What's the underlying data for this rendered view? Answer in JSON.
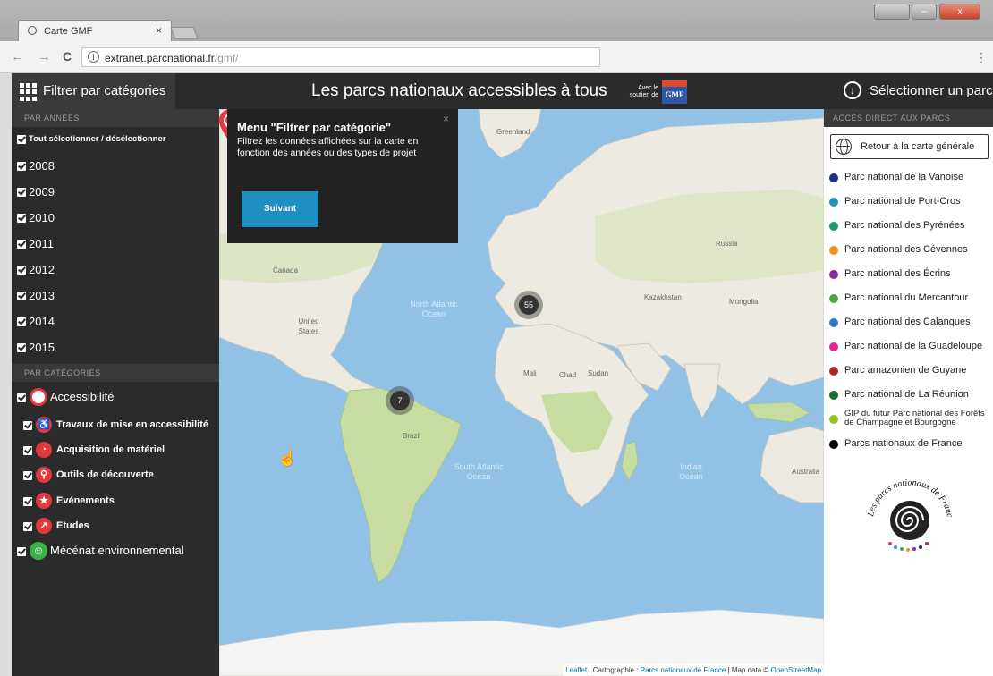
{
  "browser": {
    "tab_title": "Carte GMF",
    "tab_close": "×",
    "url_host": "extranet.parcnational.fr",
    "url_path": "/gmf/",
    "info_icon": "i",
    "back_icon": "←",
    "forward_icon": "→",
    "reload_icon": "C",
    "menu_icon": "⋮"
  },
  "header": {
    "filter_label": "Filtrer par catégories",
    "title": "Les parcs nationaux accessibles à tous",
    "sponsor_text": "Avec le soutien de",
    "sponsor_logo": "GMF",
    "select_park_label": "Sélectionner un parc",
    "select_icon": "↓"
  },
  "left": {
    "years_header": "PAR ANNÉES",
    "select_all": "Tout sélectionner / désélectionner",
    "years": [
      "2008",
      "2009",
      "2010",
      "2011",
      "2012",
      "2013",
      "2014",
      "2015"
    ],
    "categories_header": "PAR CATÉGORIES",
    "accessibility": {
      "label": "Accessibilité",
      "icon": "accessibility-icon",
      "color": "#e03a3e"
    },
    "subcategories": [
      {
        "label": "Travaux de mise en accessibilité",
        "icon": "person-icon",
        "glyph": "♿"
      },
      {
        "label": "Acquisition de matériel",
        "icon": "pie-icon",
        "glyph": "◔"
      },
      {
        "label": "Outils de découverte",
        "icon": "magnifier-icon",
        "glyph": "⚲"
      },
      {
        "label": "Evénements",
        "icon": "star-icon",
        "glyph": "★"
      },
      {
        "label": "Etudes",
        "icon": "chart-icon",
        "glyph": "↗"
      }
    ],
    "mecenat": {
      "label": "Mécénat environnemental",
      "icon": "leaf-face-icon",
      "color": "#3bb34a",
      "glyph": "☺"
    }
  },
  "popup": {
    "title": "Menu \"Filtrer par catégorie\"",
    "text": "Filtrez les données affichées sur la carte en fonction des années ou des types de projet",
    "button": "Suivant",
    "close": "×"
  },
  "map": {
    "ocean_labels": [
      {
        "text": "North Atlantic Ocean"
      },
      {
        "text": "South Atlantic Ocean"
      },
      {
        "text": "Indian Ocean"
      }
    ],
    "land_labels": [
      "Canada",
      "United States",
      "Brazil",
      "Russia",
      "Kazakhstan",
      "Australia",
      "Mongolia",
      "Sudan",
      "Chad",
      "Mali",
      "Greenland"
    ],
    "clusters": [
      {
        "count": "55"
      },
      {
        "count": "7"
      }
    ],
    "attribution_leaflet": "Leaflet",
    "attribution_mid": " | Cartographie : ",
    "attribution_pnf": "Parcs nationaux de France",
    "attribution_data": " | Map data © ",
    "attribution_osm": "OpenStreetMap",
    "colors": {
      "water": "#92c1e6",
      "land": "#eceae1",
      "green": "#c6dca0"
    }
  },
  "right": {
    "header": "ACCÈS DIRECT AUX PARCS",
    "back_label": "Retour à la carte générale",
    "parks": [
      {
        "label": "Parc national de la Vanoise",
        "color": "#1a2f8a"
      },
      {
        "label": "Parc national de Port-Cros",
        "color": "#1f95b5"
      },
      {
        "label": "Parc national des Pyrénées",
        "color": "#1b9a6a"
      },
      {
        "label": "Parc national des Cévennes",
        "color": "#f0901e"
      },
      {
        "label": "Parc national des Écrins",
        "color": "#8a2aa0"
      },
      {
        "label": "Parc national du Mercantour",
        "color": "#47a842"
      },
      {
        "label": "Parc national des Calanques",
        "color": "#2a7dc4"
      },
      {
        "label": "Parc national de la Guadeloupe",
        "color": "#e0269a"
      },
      {
        "label": "Parc amazonien de Guyane",
        "color": "#a52a2a"
      },
      {
        "label": "Parc national de La Réunion",
        "color": "#1e6b3a"
      },
      {
        "label": "GIP du futur Parc national des Forêts de Champagne et Bourgogne",
        "color": "#9ac21e"
      },
      {
        "label": "Parcs nationaux de France",
        "color": "#000000"
      }
    ],
    "logo_text": "Les parcs nationaux de France"
  },
  "window": {
    "restore": "",
    "minimize": "–",
    "close": "x"
  }
}
